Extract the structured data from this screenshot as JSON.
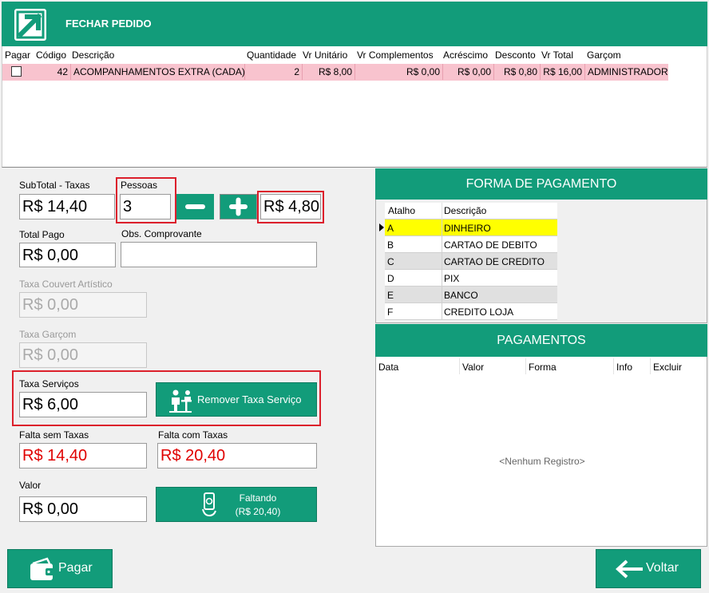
{
  "header": {
    "title": "FECHAR PEDIDO"
  },
  "items_grid": {
    "columns": [
      "Pagar",
      "Código",
      "Descrição",
      "Quantidade",
      "Vr Unitário",
      "Vr Complementos",
      "Acréscimo",
      "Desconto",
      "Vr Total",
      "Garçom"
    ],
    "rows": [
      {
        "codigo": "42",
        "descricao": "ACOMPANHAMENTOS EXTRA (CADA)",
        "quantidade": "2",
        "vr_unitario": "R$ 8,00",
        "vr_complementos": "R$ 0,00",
        "acrescimo": "R$ 0,00",
        "desconto": "R$ 0,80",
        "vr_total": "R$ 16,00",
        "garcom": "ADMINISTRADOR"
      }
    ]
  },
  "form": {
    "subtotal_label": "SubTotal - Taxas",
    "subtotal_value": "R$ 14,40",
    "pessoas_label": "Pessoas",
    "pessoas_value": "3",
    "per_person_value": "R$ 4,80",
    "total_pago_label": "Total Pago",
    "total_pago_value": "R$ 0,00",
    "obs_label": "Obs. Comprovante",
    "obs_value": "",
    "couvert_label": "Taxa Couvert Artístico",
    "couvert_value": "R$ 0,00",
    "garcom_label": "Taxa Garçom",
    "garcom_value": "R$ 0,00",
    "servicos_label": "Taxa Serviços",
    "servicos_value": "R$ 6,00",
    "remover_label": "Remover Taxa Serviço",
    "falta_sem_label": "Falta sem Taxas",
    "falta_sem_value": "R$ 14,40",
    "falta_com_label": "Falta com Taxas",
    "falta_com_value": "R$ 20,40",
    "valor_label": "Valor",
    "valor_value": "R$ 0,00",
    "faltando_label": "Faltando",
    "faltando_value": "(R$ 20,40)"
  },
  "forma_pagamento": {
    "title": "FORMA DE PAGAMENTO",
    "columns": [
      "Atalho",
      "Descrição"
    ],
    "rows": [
      {
        "atalho": "A",
        "descricao": "DINHEIRO"
      },
      {
        "atalho": "B",
        "descricao": "CARTAO DE DEBITO"
      },
      {
        "atalho": "C",
        "descricao": "CARTAO DE CREDITO"
      },
      {
        "atalho": "D",
        "descricao": "PIX"
      },
      {
        "atalho": "E",
        "descricao": "BANCO"
      },
      {
        "atalho": "F",
        "descricao": "CREDITO LOJA"
      }
    ]
  },
  "pagamentos": {
    "title": "PAGAMENTOS",
    "columns": [
      "Data",
      "Valor",
      "Forma",
      "Info",
      "Excluir"
    ],
    "empty_text": "<Nenhum Registro>"
  },
  "footer": {
    "pagar_label": "Pagar",
    "voltar_label": "Voltar"
  },
  "colors": {
    "accent": "#129c7a",
    "highlight_row": "#f8c3ce",
    "selected_row": "#ffff00",
    "alert_border": "#dc1f2b",
    "negative_text": "#e00000"
  },
  "icons": [
    "logo-icon",
    "minus-icon",
    "plus-icon",
    "waiter-icon",
    "money-hand-icon",
    "wallet-icon",
    "arrow-left-icon",
    "row-pointer-icon"
  ]
}
